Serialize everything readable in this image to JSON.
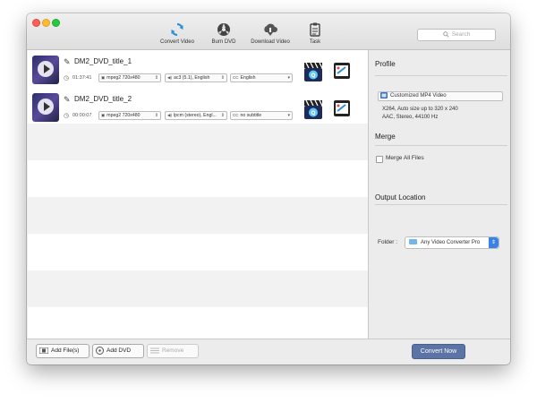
{
  "toolbar": {
    "items": [
      {
        "label": "Convert Video",
        "icon": "convert-icon"
      },
      {
        "label": "Burn DVD",
        "icon": "burn-dvd-icon"
      },
      {
        "label": "Download Video",
        "icon": "download-icon"
      },
      {
        "label": "Task",
        "icon": "task-icon"
      }
    ],
    "search_placeholder": "Search"
  },
  "files": [
    {
      "title": "DM2_DVD_title_1",
      "duration": "01:37:41",
      "video": "mpeg2 720x480",
      "audio": "ac3 (5.1), English",
      "subtitle": "English"
    },
    {
      "title": "DM2_DVD_title_2",
      "duration": "00:00:07",
      "video": "mpeg2 720x480",
      "audio": "lpcm (stereo), Engl...",
      "subtitle": "no subtitle"
    }
  ],
  "panel": {
    "profile_heading": "Profile",
    "profile_value": "Customized MP4 Video",
    "profile_info_1": "X264, Auto size up to 320 x 240",
    "profile_info_2": "AAC, Stereo, 44100 Hz",
    "merge_heading": "Merge",
    "merge_label": "Merge All Files",
    "output_heading": "Output Location",
    "folder_label": "Folder :",
    "folder_value": "Any Video Converter Pro"
  },
  "bottom": {
    "add_files": "Add File(s)",
    "add_dvd": "Add DVD",
    "remove": "Remove",
    "convert": "Convert Now"
  },
  "colors": {
    "accent": "#5b74a5",
    "select_blue": "#3b82e6"
  }
}
